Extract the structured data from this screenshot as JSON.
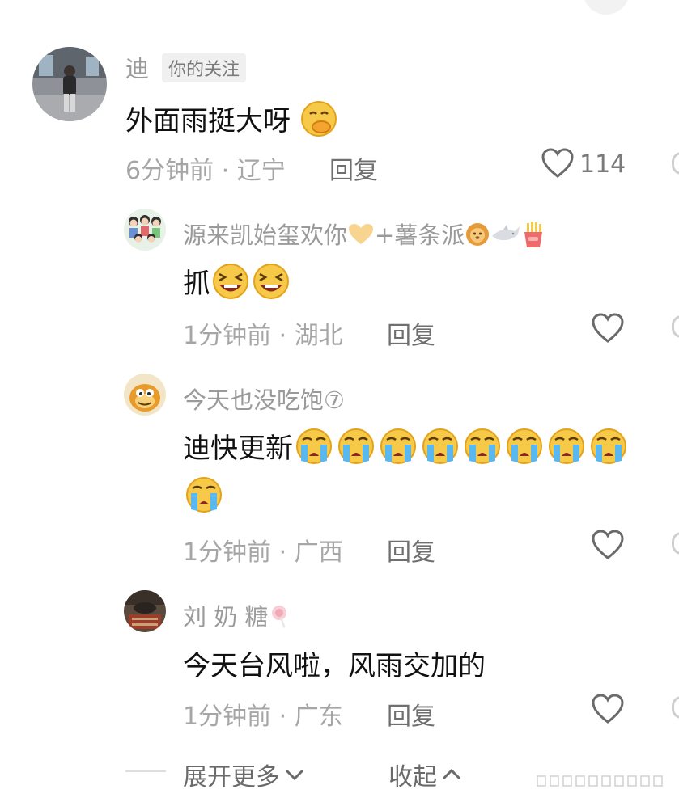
{
  "comments": [
    {
      "username": "迪",
      "badge": "你的关注",
      "content": "外面雨挺大呀",
      "time_location": "6分钟前 · 辽宁",
      "reply": "回复",
      "likes": "114"
    }
  ],
  "replies": [
    {
      "username": "源来凯始玺欢你",
      "username_suffix": "+薯条派",
      "content": "抓",
      "time_location": "1分钟前 · 湖北",
      "reply": "回复"
    },
    {
      "username": "今天也没吃饱⑦",
      "content": "迪快更新",
      "time_location": "1分钟前 · 广西",
      "reply": "回复"
    },
    {
      "username": "刘 奶 糖",
      "content": "今天台风啦，风雨交加的",
      "time_location": "1分钟前 · 广东",
      "reply": "回复"
    }
  ],
  "footer": {
    "expand": "展开更多",
    "collapse": "收起"
  },
  "colors": {
    "text_primary": "#111111",
    "text_secondary": "#9a9a9a",
    "icon_gray": "#6a6a6a"
  },
  "icons": [
    "heart-outline-icon",
    "chevron-down-icon",
    "chevron-up-icon",
    "heart-hands-icon",
    "lion-icon",
    "shark-icon",
    "fries-icon",
    "laughing-emoji",
    "crying-emoji",
    "hand-over-mouth-emoji",
    "candy-icon"
  ]
}
